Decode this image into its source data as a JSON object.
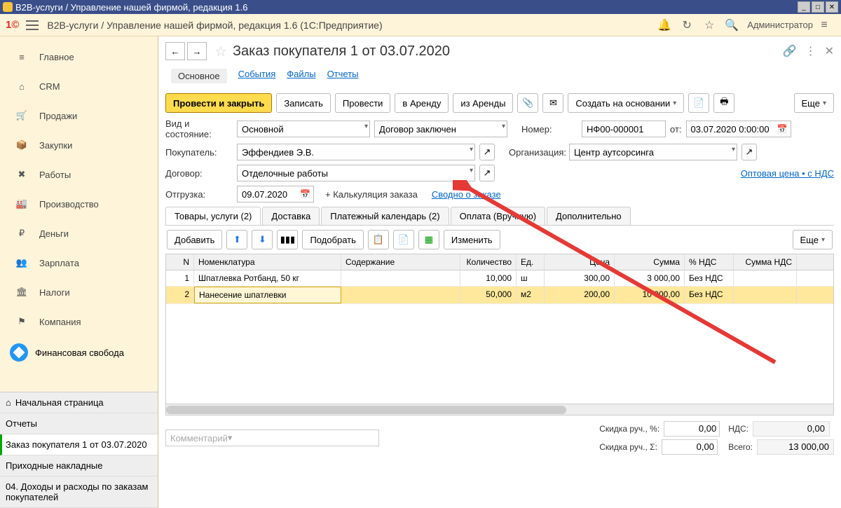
{
  "window": {
    "title": "В2В-услуги / Управление нашей фирмой, редакция 1.6"
  },
  "header": {
    "title": "В2В-услуги / Управление нашей фирмой, редакция 1.6  (1С:Предприятие)",
    "user": "Администратор"
  },
  "sidebar": {
    "items": [
      {
        "label": "Главное",
        "icon": "≡"
      },
      {
        "label": "CRM",
        "icon": "⌂"
      },
      {
        "label": "Продажи",
        "icon": "🛒"
      },
      {
        "label": "Закупки",
        "icon": "📦"
      },
      {
        "label": "Работы",
        "icon": "✖"
      },
      {
        "label": "Производство",
        "icon": "🏭"
      },
      {
        "label": "Деньги",
        "icon": "₽"
      },
      {
        "label": "Зарплата",
        "icon": "👥"
      },
      {
        "label": "Налоги",
        "icon": "🏛"
      },
      {
        "label": "Компания",
        "icon": "⚑"
      }
    ],
    "fin_label": "Финансовая свобода",
    "bottom": [
      {
        "label": "Начальная страница",
        "icon": "⌂"
      },
      {
        "label": "Отчеты"
      },
      {
        "label": "Заказ покупателя 1 от 03.07.2020",
        "active": true
      },
      {
        "label": "Приходные накладные"
      },
      {
        "label": "04. Доходы и расходы по заказам покупателей"
      }
    ]
  },
  "doc": {
    "title": "Заказ покупателя 1 от 03.07.2020",
    "tabs": [
      "Основное",
      "События",
      "Файлы",
      "Отчеты"
    ],
    "toolbar": {
      "primary": "Провести и закрыть",
      "write": "Записать",
      "post": "Провести",
      "rent_to": "в Аренду",
      "rent_from": "из Аренды",
      "create_base": "Создать на основании",
      "more": "Еще"
    },
    "fields": {
      "kind_label": "Вид и состояние:",
      "kind": "Основной",
      "state": "Договор заключен",
      "number_label": "Номер:",
      "number": "НФ00-000001",
      "from": "от:",
      "date": "03.07.2020  0:00:00",
      "buyer_label": "Покупатель:",
      "buyer": "Эффендиев Э.В.",
      "org_label": "Организация:",
      "org": "Центр аутсорсинга",
      "contract_label": "Договор:",
      "contract": "Отделочные работы",
      "price_link": "Оптовая цена • с НДС",
      "ship_label": "Отгрузка:",
      "ship_date": "09.07.2020",
      "calc_label": "+ Калькуляция заказа",
      "summary_link": "Сводно о заказе"
    },
    "inner_tabs": [
      "Товары, услуги (2)",
      "Доставка",
      "Платежный календарь (2)",
      "Оплата (Вручную)",
      "Дополнительно"
    ],
    "itoolbar": {
      "add": "Добавить",
      "pick": "Подобрать",
      "change": "Изменить",
      "more": "Еще"
    },
    "table": {
      "cols": [
        "N",
        "Номенклатура",
        "Содержание",
        "Количество",
        "Ед.",
        "Цена",
        "Сумма",
        "% НДС",
        "Сумма НДС"
      ],
      "rows": [
        {
          "n": "1",
          "nom": "Шпатлевка Ротбанд, 50 кг",
          "sod": "",
          "kol": "10,000",
          "ed": "ш",
          "cena": "300,00",
          "sum": "3 000,00",
          "nds": "Без НДС",
          "snds": ""
        },
        {
          "n": "2",
          "nom": "Нанесение шпатлевки",
          "sod": "",
          "kol": "50,000",
          "ed": "м2",
          "cena": "200,00",
          "sum": "10 000,00",
          "nds": "Без НДС",
          "snds": ""
        }
      ]
    },
    "footer": {
      "comment_ph": "Комментарий",
      "disc_pct_label": "Скидка руч., %:",
      "disc_pct": "0,00",
      "disc_sum_label": "Скидка руч., Σ:",
      "disc_sum": "0,00",
      "nds_label": "НДС:",
      "nds": "0,00",
      "total_label": "Всего:",
      "total": "13 000,00"
    }
  }
}
